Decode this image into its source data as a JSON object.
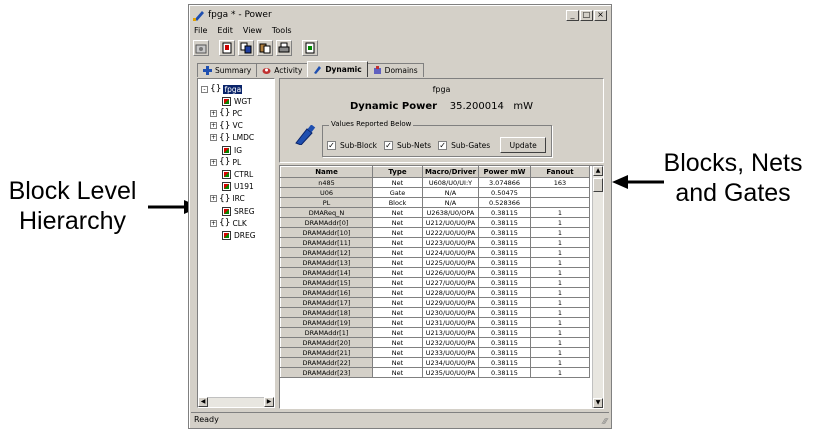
{
  "window": {
    "title": "fpga * - Power"
  },
  "menu": [
    "File",
    "Edit",
    "View",
    "Tools"
  ],
  "toolbar": [
    "open-icon",
    "report-icon",
    "copy-icon",
    "paste-icon",
    "print-icon",
    "export-icon"
  ],
  "tabs": [
    {
      "label": "Summary",
      "icon": "summary-icon",
      "active": false
    },
    {
      "label": "Activity",
      "icon": "activity-icon",
      "active": false
    },
    {
      "label": "Dynamic",
      "icon": "dynamic-icon",
      "active": true
    },
    {
      "label": "Domains",
      "icon": "domains-icon",
      "active": false
    }
  ],
  "tree": [
    {
      "label": "fpga",
      "kind": "block",
      "expander": "-",
      "level": 0,
      "selected": true
    },
    {
      "label": "WGT",
      "kind": "leaf",
      "level": 1
    },
    {
      "label": "PC",
      "kind": "block",
      "expander": "+",
      "level": 1
    },
    {
      "label": "VC",
      "kind": "block",
      "expander": "+",
      "level": 1
    },
    {
      "label": "LMDC",
      "kind": "block",
      "expander": "+",
      "level": 1
    },
    {
      "label": "IG",
      "kind": "leaf",
      "level": 1
    },
    {
      "label": "PL",
      "kind": "block",
      "expander": "+",
      "level": 1
    },
    {
      "label": "CTRL",
      "kind": "leaf",
      "level": 1
    },
    {
      "label": "U191",
      "kind": "leaf",
      "level": 1
    },
    {
      "label": "IRC",
      "kind": "block",
      "expander": "+",
      "level": 1
    },
    {
      "label": "SREG",
      "kind": "leaf",
      "level": 1
    },
    {
      "label": "CLK",
      "kind": "block",
      "expander": "+",
      "level": 1
    },
    {
      "label": "DREG",
      "kind": "leaf",
      "level": 1
    }
  ],
  "dynamic": {
    "block_name": "fpga",
    "power_label": "Dynamic Power",
    "power_value": "35.200014",
    "power_unit": "mW",
    "options_legend": "Values Reported Below",
    "checkboxes": [
      {
        "label": "Sub-Block",
        "checked": true
      },
      {
        "label": "Sub-Nets",
        "checked": true
      },
      {
        "label": "Sub-Gates",
        "checked": true
      }
    ],
    "update_label": "Update"
  },
  "table": {
    "columns": [
      "Name",
      "Type",
      "Macro/Driver",
      "Power mW",
      "Fanout"
    ],
    "rows": [
      [
        "n485",
        "Net",
        "U608/U0/UI:Y",
        "3.074866",
        "163"
      ],
      [
        "U06",
        "Gate",
        "N/A",
        "0.50475",
        ""
      ],
      [
        "PL",
        "Block",
        "N/A",
        "0.528366",
        ""
      ],
      [
        "DMAReq_N",
        "Net",
        "U2638/U0/OPA",
        "0.38115",
        "1"
      ],
      [
        "DRAMAddr[0]",
        "Net",
        "U212/U0/U0/PA",
        "0.38115",
        "1"
      ],
      [
        "DRAMAddr[10]",
        "Net",
        "U222/U0/U0/PA",
        "0.38115",
        "1"
      ],
      [
        "DRAMAddr[11]",
        "Net",
        "U223/U0/U0/PA",
        "0.38115",
        "1"
      ],
      [
        "DRAMAddr[12]",
        "Net",
        "U224/U0/U0/PA",
        "0.38115",
        "1"
      ],
      [
        "DRAMAddr[13]",
        "Net",
        "U225/U0/U0/PA",
        "0.38115",
        "1"
      ],
      [
        "DRAMAddr[14]",
        "Net",
        "U226/U0/U0/PA",
        "0.38115",
        "1"
      ],
      [
        "DRAMAddr[15]",
        "Net",
        "U227/U0/U0/PA",
        "0.38115",
        "1"
      ],
      [
        "DRAMAddr[16]",
        "Net",
        "U228/U0/U0/PA",
        "0.38115",
        "1"
      ],
      [
        "DRAMAddr[17]",
        "Net",
        "U229/U0/U0/PA",
        "0.38115",
        "1"
      ],
      [
        "DRAMAddr[18]",
        "Net",
        "U230/U0/U0/PA",
        "0.38115",
        "1"
      ],
      [
        "DRAMAddr[19]",
        "Net",
        "U231/U0/U0/PA",
        "0.38115",
        "1"
      ],
      [
        "DRAMAddr[1]",
        "Net",
        "U213/U0/U0/PA",
        "0.38115",
        "1"
      ],
      [
        "DRAMAddr[20]",
        "Net",
        "U232/U0/U0/PA",
        "0.38115",
        "1"
      ],
      [
        "DRAMAddr[21]",
        "Net",
        "U233/U0/U0/PA",
        "0.38115",
        "1"
      ],
      [
        "DRAMAddr[22]",
        "Net",
        "U234/U0/U0/PA",
        "0.38115",
        "1"
      ],
      [
        "DRAMAddr[23]",
        "Net",
        "U235/U0/U0/PA",
        "0.38115",
        "1"
      ]
    ]
  },
  "status": {
    "text": "Ready"
  },
  "annotations": {
    "left": "Block Level Hierarchy",
    "right": "Blocks, Nets and Gates"
  }
}
